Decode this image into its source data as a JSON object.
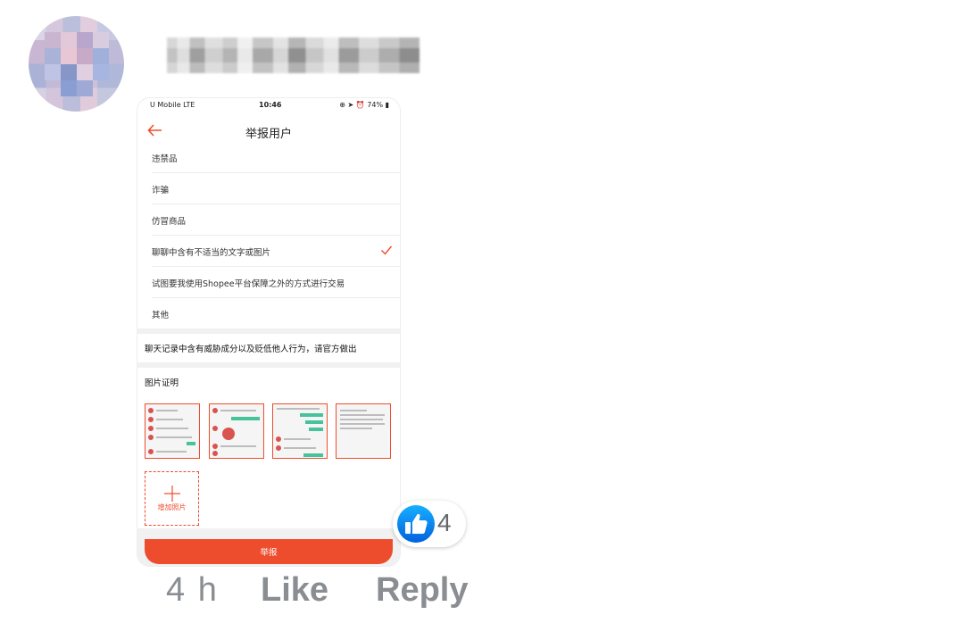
{
  "comment": {
    "time": "4 h",
    "like_label": "Like",
    "reply_label": "Reply",
    "reaction_count": "4"
  },
  "screenshot": {
    "status_bar": {
      "carrier": "U Mobile  LTE",
      "time": "10:46",
      "right": "⊕ ➤ ⏰ 74% ▮"
    },
    "title": "举报用户",
    "reasons": [
      {
        "label": "违禁品",
        "selected": false
      },
      {
        "label": "诈骗",
        "selected": false
      },
      {
        "label": "仿冒商品",
        "selected": false
      },
      {
        "label": "聊聊中含有不适当的文字或图片",
        "selected": true
      },
      {
        "label": "试图要我使用Shopee平台保障之外的方式进行交易",
        "selected": false
      },
      {
        "label": "其他",
        "selected": false
      }
    ],
    "description": "聊天记录中含有威胁成分以及贬低他人行为，请官方做出",
    "proof_label": "图片证明",
    "add_photo_label": "增加照片",
    "submit_label": "举报"
  },
  "colors": {
    "accent": "#ee4d2d",
    "facebook_blue": "#1877f2",
    "muted_text": "#8a8d91"
  }
}
